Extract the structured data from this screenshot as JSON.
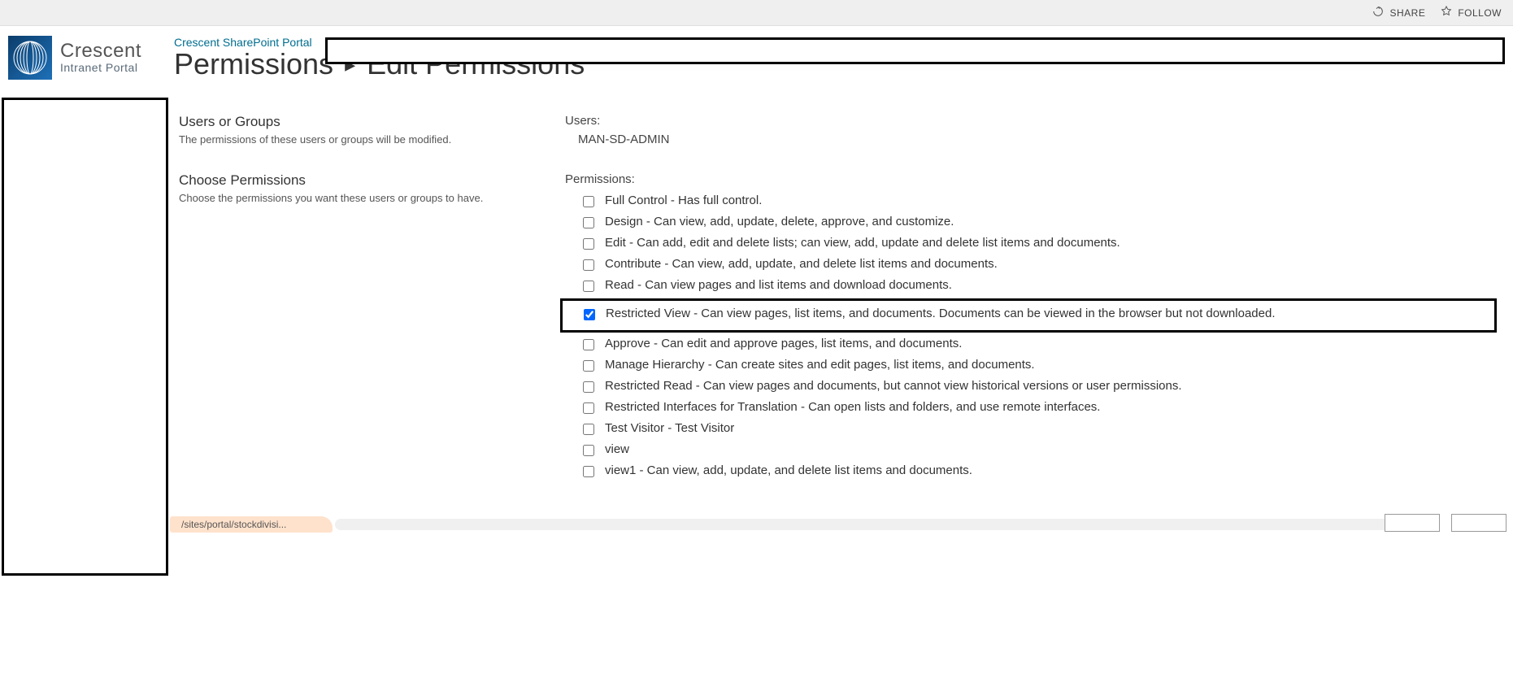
{
  "ribbon": {
    "share": "SHARE",
    "follow": "FOLLOW"
  },
  "logo": {
    "main": "Crescent",
    "sub": "Intranet Portal"
  },
  "header": {
    "portal_link": "Crescent SharePoint Portal",
    "title_left": "Permissions",
    "title_right": "Edit Permissions"
  },
  "sections": {
    "users": {
      "title": "Users or Groups",
      "desc": "The permissions of these users or groups will be modified.",
      "right_label": "Users:",
      "user_value": "MAN-SD-ADMIN"
    },
    "choose": {
      "title": "Choose Permissions",
      "desc": "Choose the permissions you want these users or groups to have.",
      "right_label": "Permissions:"
    }
  },
  "permissions": [
    {
      "label": "Full Control - Has full control.",
      "checked": false,
      "highlight": false
    },
    {
      "label": "Design - Can view, add, update, delete, approve, and customize.",
      "checked": false,
      "highlight": false
    },
    {
      "label": "Edit - Can add, edit and delete lists; can view, add, update and delete list items and documents.",
      "checked": false,
      "highlight": false
    },
    {
      "label": "Contribute - Can view, add, update, and delete list items and documents.",
      "checked": false,
      "highlight": false
    },
    {
      "label": "Read - Can view pages and list items and download documents.",
      "checked": false,
      "highlight": false
    },
    {
      "label": "Restricted View - Can view pages, list items, and documents. Documents can be viewed in the browser but not downloaded.",
      "checked": true,
      "highlight": true
    },
    {
      "label": "Approve - Can edit and approve pages, list items, and documents.",
      "checked": false,
      "highlight": false
    },
    {
      "label": "Manage Hierarchy - Can create sites and edit pages, list items, and documents.",
      "checked": false,
      "highlight": false
    },
    {
      "label": "Restricted Read - Can view pages and documents, but cannot view historical versions or user permissions.",
      "checked": false,
      "highlight": false
    },
    {
      "label": "Restricted Interfaces for Translation - Can open lists and folders, and use remote interfaces.",
      "checked": false,
      "highlight": false
    },
    {
      "label": "Test Visitor - Test Visitor",
      "checked": false,
      "highlight": false
    },
    {
      "label": "view",
      "checked": false,
      "highlight": false
    },
    {
      "label": "view1 - Can view, add, update, and delete list items and documents.",
      "checked": false,
      "highlight": false
    }
  ],
  "crumb": "/sites/portal/stockdivisi..."
}
